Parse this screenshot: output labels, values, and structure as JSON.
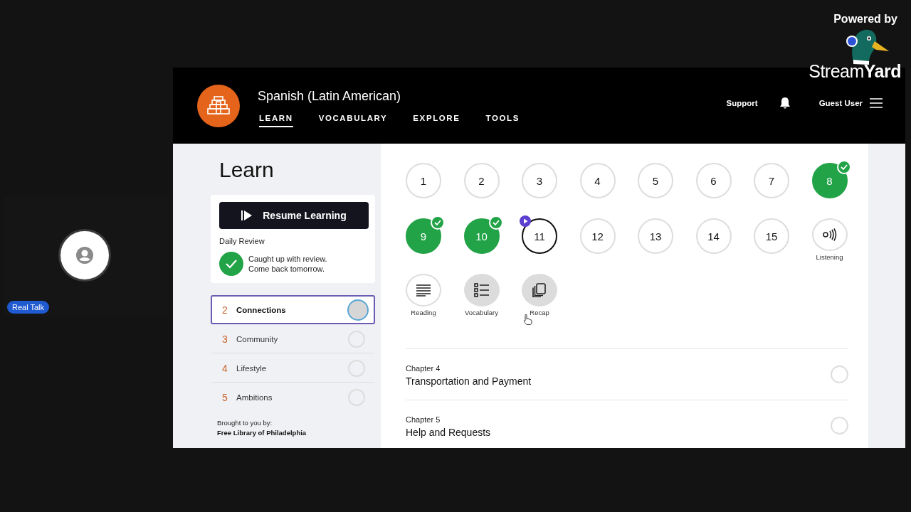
{
  "stream": {
    "participant": {
      "name": "Real Talk"
    },
    "branding": {
      "powered_by": "Powered by",
      "logo": "Stream**Yard**"
    }
  },
  "header": {
    "title": "Spanish (Latin American)",
    "tabs": [
      {
        "label": "LEARN",
        "selected": true
      },
      {
        "label": "VOCABULARY",
        "selected": false
      },
      {
        "label": "EXPLORE",
        "selected": false
      },
      {
        "label": "TOOLS",
        "selected": false
      }
    ],
    "support": "Support",
    "user": "Guest User"
  },
  "sidebar": {
    "heading": "Learn",
    "resume_button": "Resume Learning",
    "daily_review": "Daily Review",
    "review_status": [
      "Caught up with review.",
      "Come back tomorrow."
    ],
    "units": [
      {
        "number": "2",
        "title": "Connections",
        "selected": true
      },
      {
        "number": "3",
        "title": "Community",
        "selected": false
      },
      {
        "number": "4",
        "title": "Lifestyle",
        "selected": false
      },
      {
        "number": "5",
        "title": "Ambitions",
        "selected": false
      }
    ],
    "sponsor_label": "Brought to you by:",
    "sponsor": "Free Library of Philadelphia"
  },
  "lessons": [
    {
      "kind": "number",
      "label": "1",
      "completed": false,
      "current": false,
      "visited": false
    },
    {
      "kind": "number",
      "label": "2",
      "completed": false,
      "current": false,
      "visited": false
    },
    {
      "kind": "number",
      "label": "3",
      "completed": false,
      "current": false,
      "visited": false
    },
    {
      "kind": "number",
      "label": "4",
      "completed": false,
      "current": false,
      "visited": false
    },
    {
      "kind": "number",
      "label": "5",
      "completed": false,
      "current": false,
      "visited": false
    },
    {
      "kind": "number",
      "label": "6",
      "completed": false,
      "current": false,
      "visited": false
    },
    {
      "kind": "number",
      "label": "7",
      "completed": false,
      "current": false,
      "visited": false
    },
    {
      "kind": "number",
      "label": "8",
      "completed": true,
      "current": false,
      "visited": false
    },
    {
      "kind": "number",
      "label": "9",
      "completed": true,
      "current": false,
      "visited": false
    },
    {
      "kind": "number",
      "label": "10",
      "completed": true,
      "current": false,
      "visited": false
    },
    {
      "kind": "number",
      "label": "11",
      "completed": false,
      "current": true,
      "visited": false
    },
    {
      "kind": "number",
      "label": "12",
      "completed": false,
      "current": false,
      "visited": false
    },
    {
      "kind": "number",
      "label": "13",
      "completed": false,
      "current": false,
      "visited": false
    },
    {
      "kind": "number",
      "label": "14",
      "completed": false,
      "current": false,
      "visited": false
    },
    {
      "kind": "number",
      "label": "15",
      "completed": false,
      "current": false,
      "visited": false
    },
    {
      "kind": "listening",
      "label": "Listening",
      "completed": false,
      "current": false,
      "visited": false
    },
    {
      "kind": "reading",
      "label": "Reading",
      "completed": false,
      "current": false,
      "visited": false
    },
    {
      "kind": "vocabulary",
      "label": "Vocabulary",
      "completed": false,
      "current": false,
      "visited": true
    },
    {
      "kind": "recap",
      "label": "Recap",
      "completed": false,
      "current": false,
      "visited": true
    }
  ],
  "chapters": [
    {
      "chapter": "Chapter 4",
      "title": "Transportation and Payment"
    },
    {
      "chapter": "Chapter 5",
      "title": "Help and Requests"
    }
  ]
}
